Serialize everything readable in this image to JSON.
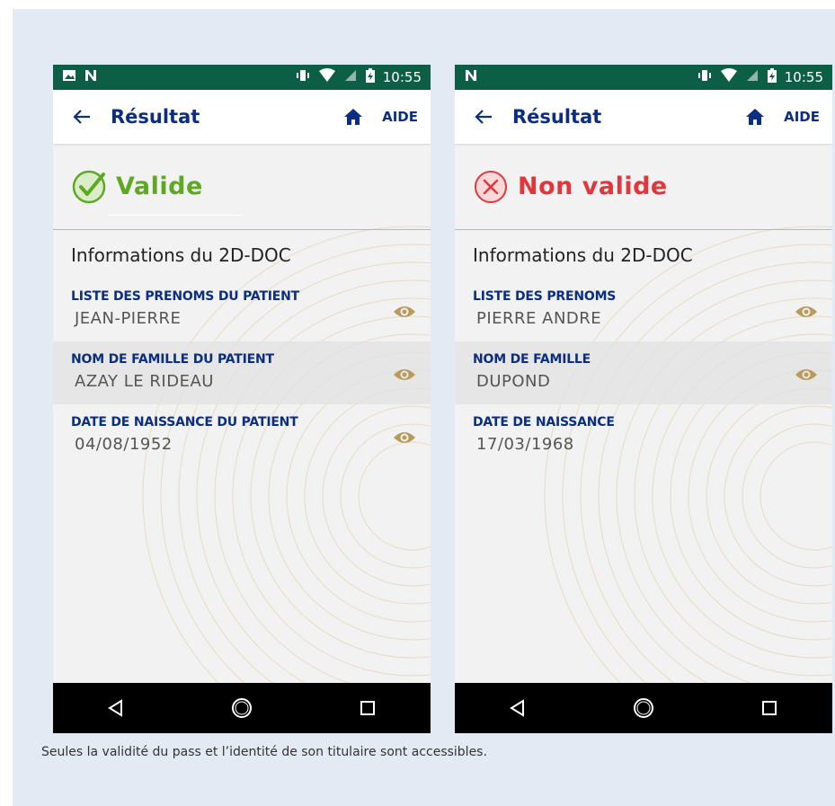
{
  "caption": "Seules la validité du pass et l’identité de son titulaire sont accessibles.",
  "colors": {
    "status_bar": "#0c5f44",
    "primary_text": "#0b2e80",
    "valid": "#5fa823",
    "invalid": "#e2363d",
    "eye": "#b89a5a"
  },
  "screens": [
    {
      "status_bar": {
        "time": "10:55",
        "left_icons": [
          "image-icon",
          "n-icon"
        ],
        "right_icons": [
          "vibrate-icon",
          "wifi-icon",
          "no-sim-icon",
          "battery-charging-icon"
        ]
      },
      "app_bar": {
        "back_icon": "arrow-left-icon",
        "title": "Résultat",
        "home_icon": "home-icon",
        "help_label": "AIDE"
      },
      "result": {
        "status": "Valide",
        "icon": "check-circle-icon"
      },
      "section_title": "Informations du 2D-DOC",
      "fields": [
        {
          "label": "LISTE DES PRENOMS DU PATIENT",
          "value": "JEAN-PIERRE"
        },
        {
          "label": "NOM DE FAMILLE DU PATIENT",
          "value": "AZAY LE RIDEAU"
        },
        {
          "label": "DATE DE NAISSANCE DU PATIENT",
          "value": "04/08/1952"
        }
      ],
      "nav_bar": [
        "back-triangle-icon",
        "home-circle-icon",
        "recents-square-icon"
      ]
    },
    {
      "status_bar": {
        "time": "10:55",
        "left_icons": [
          "n-icon"
        ],
        "right_icons": [
          "vibrate-icon",
          "wifi-icon",
          "no-sim-icon",
          "battery-charging-icon"
        ]
      },
      "app_bar": {
        "back_icon": "arrow-left-icon",
        "title": "Résultat",
        "home_icon": "home-icon",
        "help_label": "AIDE"
      },
      "result": {
        "status": "Non valide",
        "icon": "x-circle-icon"
      },
      "section_title": "Informations du 2D-DOC",
      "fields": [
        {
          "label": "LISTE DES PRENOMS",
          "value": "PIERRE ANDRE"
        },
        {
          "label": "NOM DE FAMILLE",
          "value": "DUPOND"
        },
        {
          "label": "DATE DE NAISSANCE",
          "value": "17/03/1968"
        }
      ],
      "nav_bar": [
        "back-triangle-icon",
        "home-circle-icon",
        "recents-square-icon"
      ]
    }
  ]
}
